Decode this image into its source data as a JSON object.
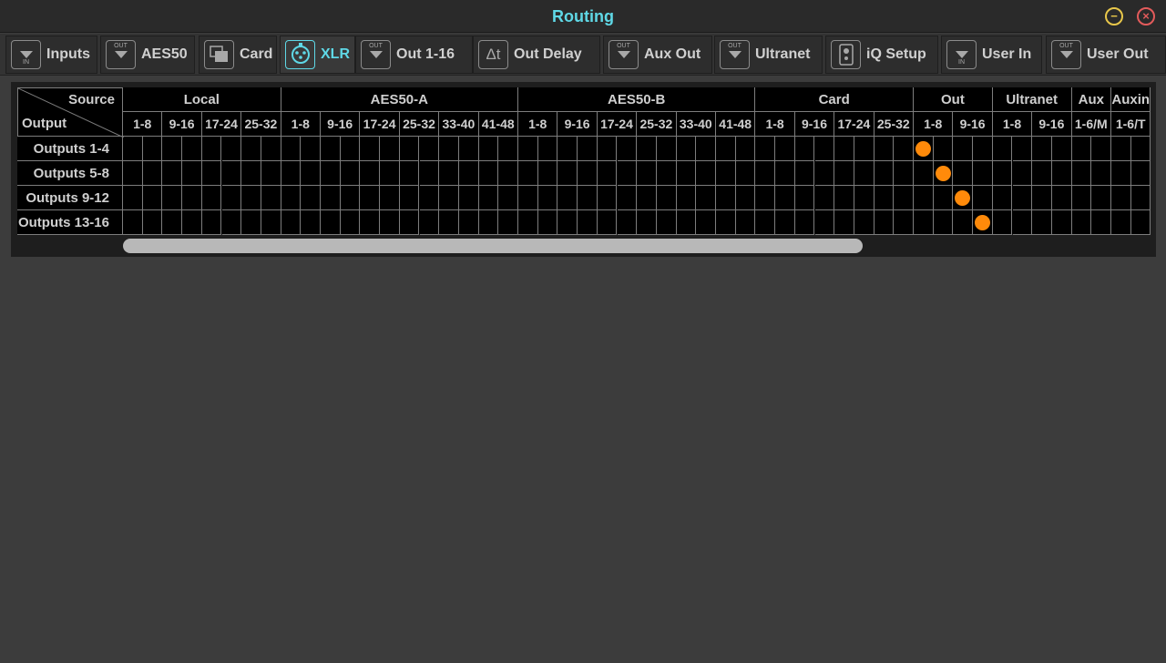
{
  "window": {
    "title": "Routing",
    "minimize_symbol": "−",
    "close_symbol": "×",
    "accent": "#5fd8e6"
  },
  "tabs": [
    {
      "label": "Inputs",
      "icon": "input-icon",
      "io": "IN",
      "active": false
    },
    {
      "label": "AES50",
      "icon": "output-icon",
      "io": "OUT",
      "active": false
    },
    {
      "label": "Card",
      "icon": "card-icon",
      "io": "",
      "active": false
    },
    {
      "label": "XLR",
      "icon": "xlr-connector-icon",
      "io": "",
      "active": true
    },
    {
      "label": "Out 1-16",
      "icon": "output-icon",
      "io": "OUT",
      "active": false
    },
    {
      "label": "Out Delay",
      "icon": "delay-icon",
      "io": "Δt",
      "active": false
    },
    {
      "label": "Aux Out",
      "icon": "output-icon",
      "io": "OUT",
      "active": false
    },
    {
      "label": "Ultranet",
      "icon": "output-icon",
      "io": "OUT",
      "active": false
    },
    {
      "label": "iQ Setup",
      "icon": "speaker-icon",
      "io": "",
      "active": false
    },
    {
      "label": "User In",
      "icon": "input-icon",
      "io": "IN",
      "active": false
    },
    {
      "label": "User Out",
      "icon": "output-icon",
      "io": "OUT",
      "active": false
    }
  ],
  "matrix": {
    "corner_source": "Source",
    "corner_output": "Output",
    "groups": [
      {
        "name": "Local",
        "columns": [
          "1-8",
          "9-16",
          "17-24",
          "25-32"
        ]
      },
      {
        "name": "AES50-A",
        "columns": [
          "1-8",
          "9-16",
          "17-24",
          "25-32",
          "33-40",
          "41-48"
        ]
      },
      {
        "name": "AES50-B",
        "columns": [
          "1-8",
          "9-16",
          "17-24",
          "25-32",
          "33-40",
          "41-48"
        ]
      },
      {
        "name": "Card",
        "columns": [
          "1-8",
          "9-16",
          "17-24",
          "25-32"
        ]
      },
      {
        "name": "Out",
        "columns": [
          "1-8",
          "9-16"
        ]
      },
      {
        "name": "Ultranet",
        "columns": [
          "1-8",
          "9-16"
        ]
      },
      {
        "name": "Aux",
        "columns": [
          "1-6/M"
        ]
      },
      {
        "name": "Auxin",
        "columns": [
          "1-6/T"
        ]
      }
    ],
    "rows": [
      "Outputs 1-4",
      "Outputs 5-8",
      "Outputs 9-12",
      "Outputs 13-16"
    ],
    "routes": [
      {
        "row": 0,
        "sub_col": 40
      },
      {
        "row": 1,
        "sub_col": 41
      },
      {
        "row": 2,
        "sub_col": 42
      },
      {
        "row": 3,
        "sub_col": 43
      }
    ],
    "route_color": "#ff8a0a"
  }
}
